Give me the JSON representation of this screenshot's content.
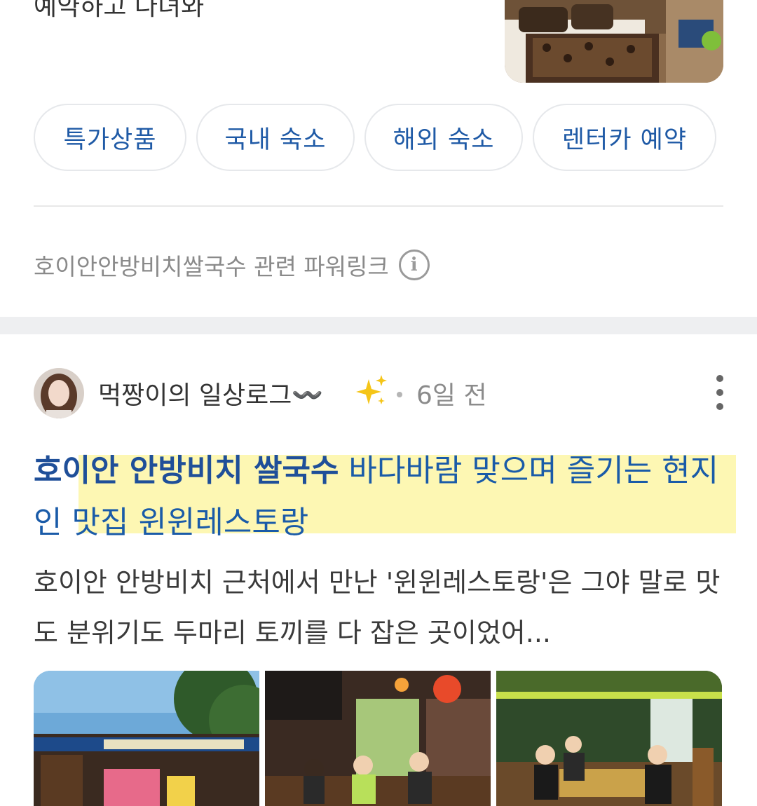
{
  "top": {
    "cut_text": "예약하고 다녀와",
    "chips": [
      {
        "label": "특가상품"
      },
      {
        "label": "국내 숙소"
      },
      {
        "label": "해외 숙소"
      },
      {
        "label": "렌터카 예약"
      }
    ],
    "powerlink": "호이안안방비치쌀국수 관련 파워링크",
    "info_icon_glyph": "i"
  },
  "post": {
    "author": "먹짱이의 일상로그〰️",
    "sparkle_icon": "sparkles-icon",
    "time": "6일 전",
    "title_bold": "호이안 안방비치 쌀국수",
    "title_rest": " 바다바람 맞으며 즐기는 현지인 맛집 윈윈레스토랑",
    "snippet": "호이안 안방비치 근처에서 만난 '윈윈레스토랑'은 그야 말로 맛도 분위기도 두마리 토끼를 다 잡은 곳이었어...",
    "images": [
      {
        "alt": "restaurant-exterior"
      },
      {
        "alt": "restaurant-interior-lanterns"
      },
      {
        "alt": "restaurant-terrace"
      }
    ]
  },
  "colors": {
    "chip_text": "#1f5aa6",
    "title_blue": "#1a5ba8",
    "highlight": "#fdf6a6",
    "band_gray": "#eeeff1"
  }
}
